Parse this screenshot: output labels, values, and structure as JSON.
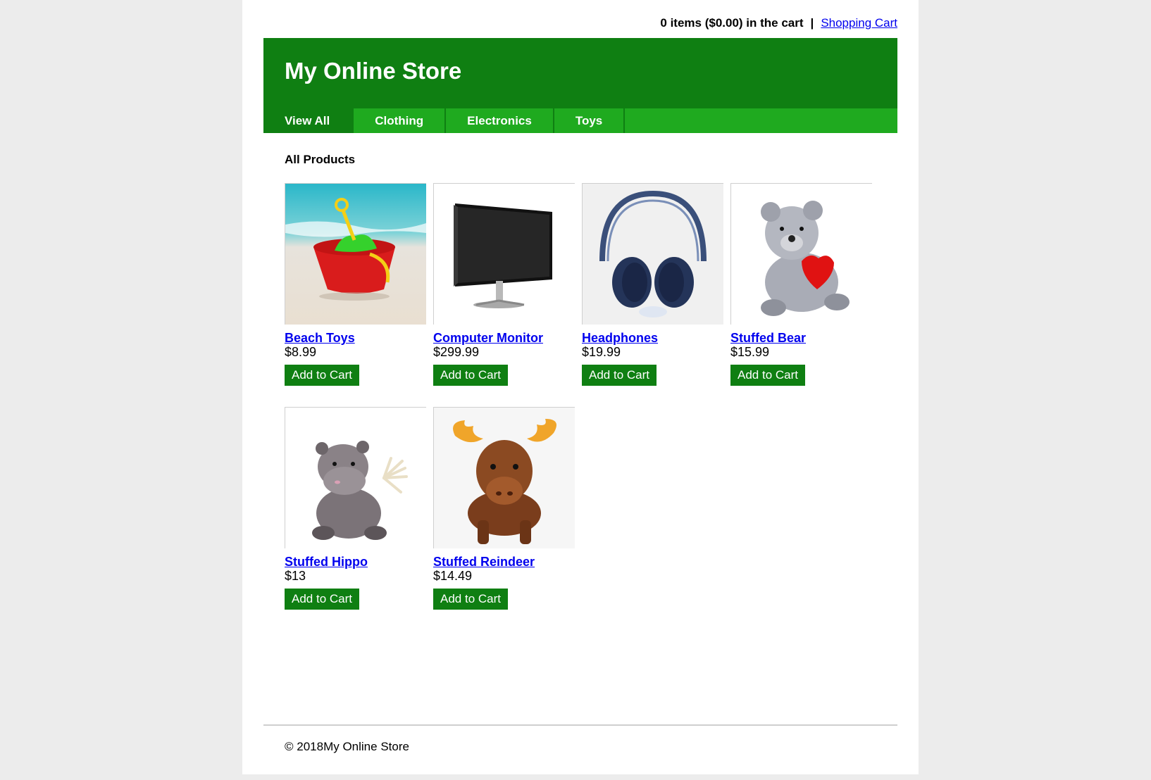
{
  "cart": {
    "summary": "0 items ($0.00) in the cart",
    "separator": "|",
    "link_label": "Shopping Cart"
  },
  "header": {
    "title": "My Online Store",
    "tabs": [
      {
        "label": "View All",
        "active": true
      },
      {
        "label": "Clothing",
        "active": false
      },
      {
        "label": "Electronics",
        "active": false
      },
      {
        "label": "Toys",
        "active": false
      }
    ]
  },
  "main": {
    "section_title": "All Products",
    "products": [
      {
        "name": "Beach Toys",
        "price": "$8.99",
        "button": "Add to Cart",
        "image": "beach-bucket-image"
      },
      {
        "name": "Computer Monitor",
        "price": "$299.99",
        "button": "Add to Cart",
        "image": "monitor-image"
      },
      {
        "name": "Headphones",
        "price": "$19.99",
        "button": "Add to Cart",
        "image": "headphones-image"
      },
      {
        "name": "Stuffed Bear",
        "price": "$15.99",
        "button": "Add to Cart",
        "image": "teddy-bear-image"
      },
      {
        "name": "Stuffed Hippo",
        "price": "$13",
        "button": "Add to Cart",
        "image": "hippo-plush-image"
      },
      {
        "name": "Stuffed Reindeer",
        "price": "$14.49",
        "button": "Add to Cart",
        "image": "reindeer-plush-image"
      }
    ]
  },
  "footer": {
    "text": "© 2018My Online Store"
  },
  "colors": {
    "header_green": "#0f7f12",
    "nav_green": "#1faa1f",
    "button_green": "#0f7f12",
    "link_blue": "#0000ee",
    "page_background": "#ececec"
  }
}
